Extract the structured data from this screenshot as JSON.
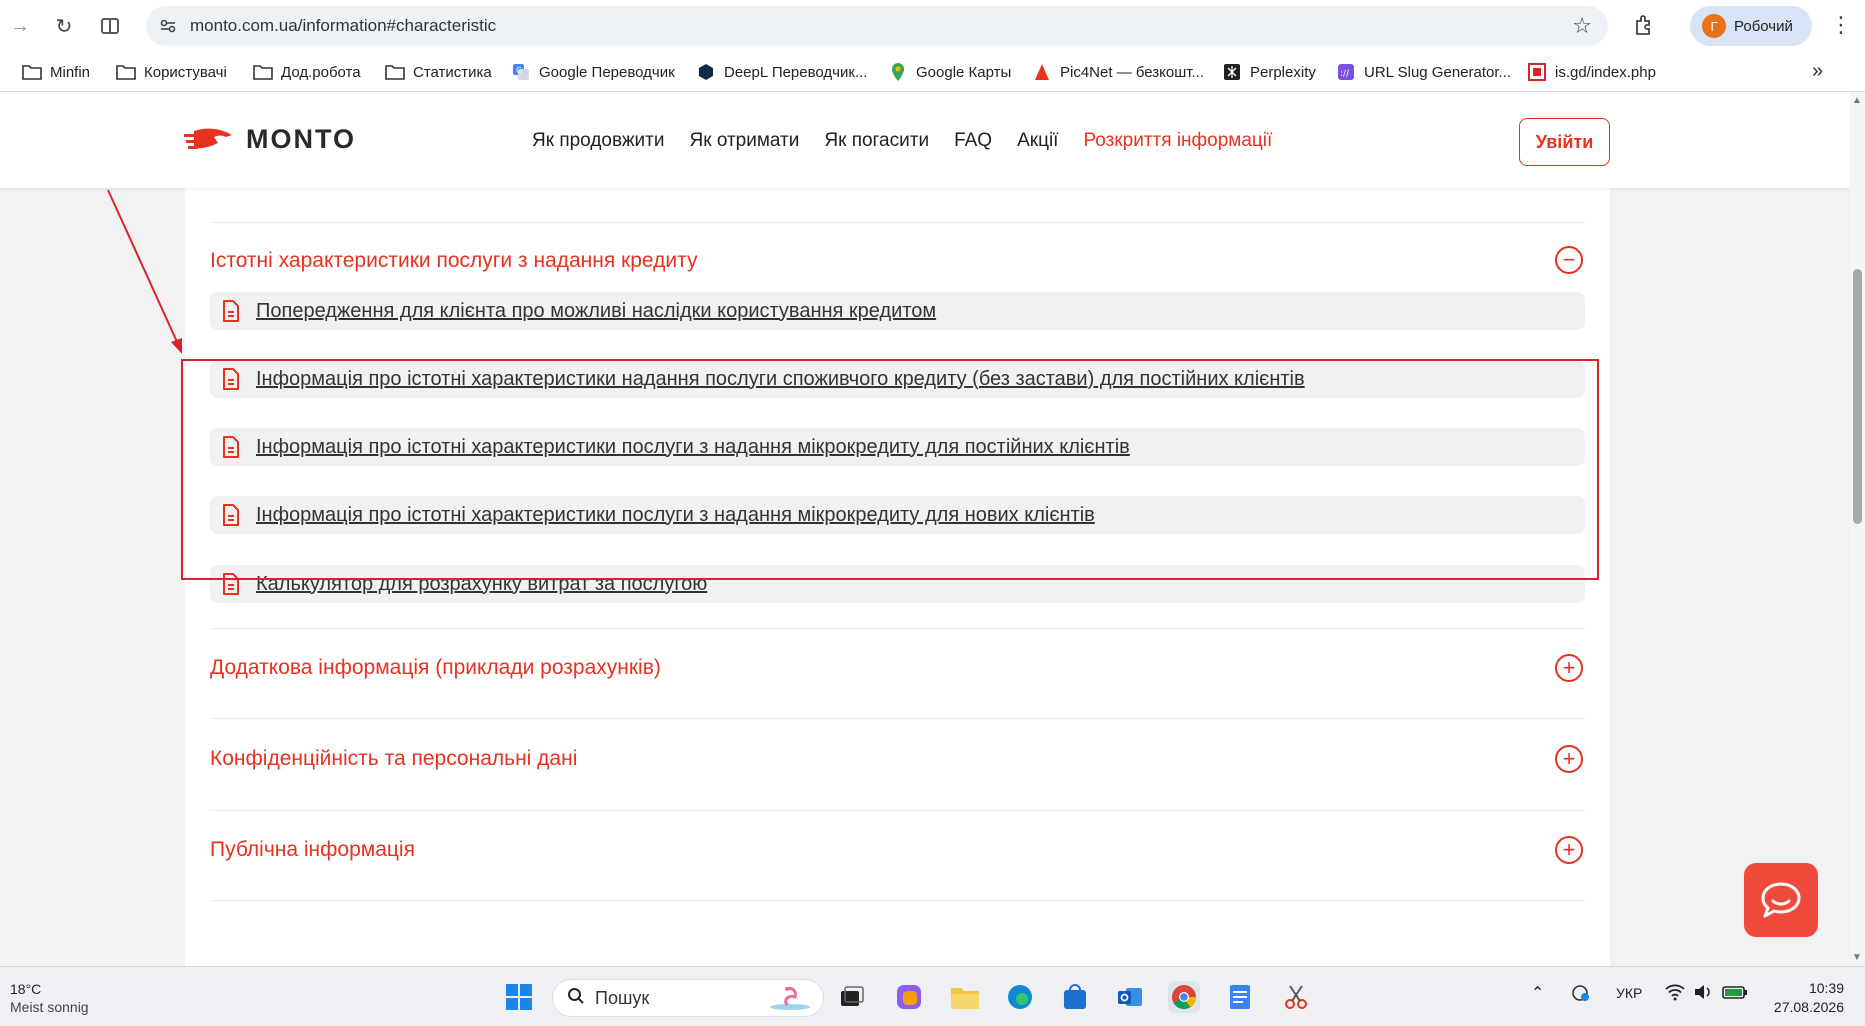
{
  "browser": {
    "url": "monto.com.ua/information#characteristic",
    "profile_initial": "Г",
    "profile_name": "Робочий",
    "bookmarks": [
      {
        "label": "Minfin",
        "icon": "folder-icon"
      },
      {
        "label": "Користувачі",
        "icon": "folder-icon"
      },
      {
        "label": "Дод.робота",
        "icon": "folder-icon"
      },
      {
        "label": "Статистика",
        "icon": "folder-icon"
      },
      {
        "label": "Google Переводчик",
        "icon": "google-translate-icon"
      },
      {
        "label": "DeepL Переводчик...",
        "icon": "deepl-icon"
      },
      {
        "label": "Google Карты",
        "icon": "maps-pin-icon"
      },
      {
        "label": "Pic4Net — безкошт...",
        "icon": "pic4net-icon"
      },
      {
        "label": "Perplexity",
        "icon": "perplexity-icon"
      },
      {
        "label": "URL Slug Generator...",
        "icon": "slug-icon"
      },
      {
        "label": "is.gd/index.php",
        "icon": "isgd-icon"
      }
    ]
  },
  "site": {
    "logo_text": "MONTO",
    "nav": [
      {
        "label": "Як продовжити",
        "active": false
      },
      {
        "label": "Як отримати",
        "active": false
      },
      {
        "label": "Як погасити",
        "active": false
      },
      {
        "label": "FAQ",
        "active": false
      },
      {
        "label": "Акції",
        "active": false
      },
      {
        "label": "Розкриття інформації",
        "active": true
      }
    ],
    "login_label": "Увійти"
  },
  "accordion": {
    "open_section": {
      "title": "Істотні характеристики послуги з надання кредиту",
      "toggle": "−",
      "documents": [
        "Попередження для клієнта про можливі наслідки користування кредитом",
        "Інформація про істотні характеристики надання послуги споживчого кредиту (без застави) для постійних клієнтів",
        "Інформація про істотні характеристики послуги з надання мікрокредиту для постійних клієнтів",
        "Інформація про істотні характеристики послуги з надання мікрокредиту для нових клієнтів",
        "Калькулятор для розрахунку витрат за послугою"
      ]
    },
    "closed_sections": [
      {
        "title": "Додаткова інформація (приклади розрахунків)",
        "toggle": "+"
      },
      {
        "title": "Конфіденційність та персональні дані",
        "toggle": "+"
      },
      {
        "title": "Публічна інформація",
        "toggle": "+"
      }
    ]
  },
  "colors": {
    "brand_red": "#e8321f",
    "annotation_red": "#d9232c"
  },
  "taskbar": {
    "temperature": "18°C",
    "weather": "Meist sonnig",
    "search_placeholder": "Пошук",
    "language": "УКР",
    "time": "10:39",
    "date": "27.08.2026"
  }
}
